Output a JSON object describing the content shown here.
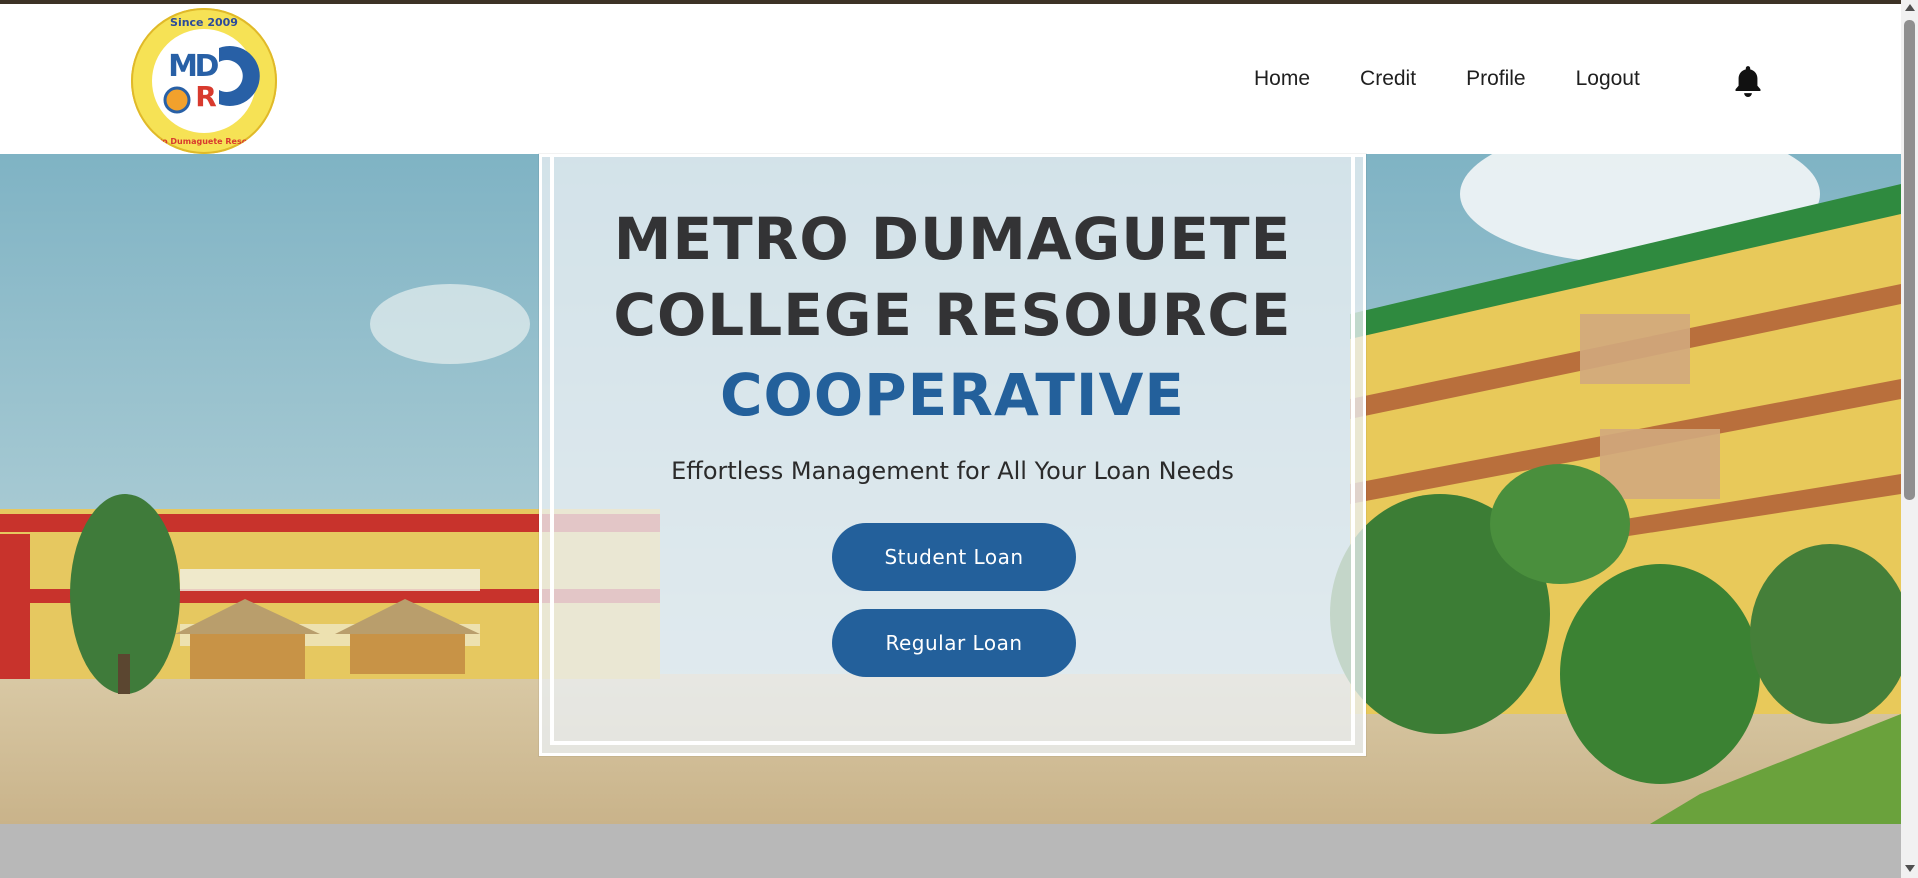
{
  "header": {
    "logo": {
      "since": "Since 2009",
      "letters": "MDRC",
      "ring_text": "Metro Dumaguete Resource Cooperative"
    },
    "nav": [
      "Home",
      "Credit",
      "Profile",
      "Logout"
    ],
    "notification_icon": "bell-icon"
  },
  "hero": {
    "title_line1": "METRO DUMAGUETE",
    "title_line2": "COLLEGE RESOURCE",
    "title_line3": "COOPERATIVE",
    "subtitle": "Effortless Management for All Your Loan Needs",
    "buttons": {
      "student_loan": "Student Loan",
      "regular_loan": "Regular Loan"
    }
  },
  "colors": {
    "accent": "#23609b",
    "text_dark": "#333335",
    "logo_yellow": "#f6e255"
  }
}
